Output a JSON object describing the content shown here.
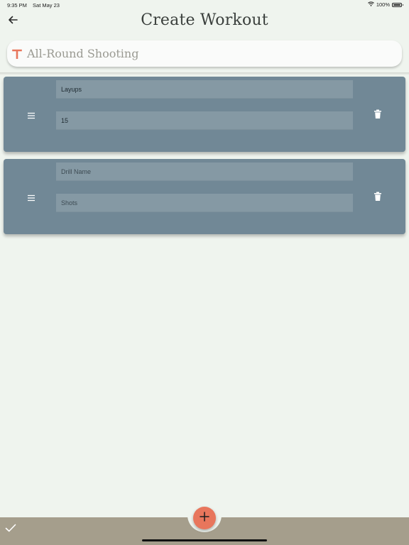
{
  "status_bar": {
    "time": "9:35 PM",
    "date": "Sat May 23",
    "battery": "100%",
    "icons": [
      "wifi-icon",
      "battery-icon"
    ]
  },
  "header": {
    "title": "Create Workout",
    "back_icon": "arrow-left-icon"
  },
  "workout_name": {
    "value": "All-Round Shooting",
    "icon": "text-t-icon"
  },
  "drills": [
    {
      "name_value": "Layups",
      "name_placeholder": "Drill Name",
      "shots_value": "15",
      "shots_placeholder": "Shots",
      "handle_icon": "drag-handle-icon",
      "delete_icon": "trash-icon"
    },
    {
      "name_value": "",
      "name_placeholder": "Drill Name",
      "shots_value": "",
      "shots_placeholder": "Shots",
      "handle_icon": "drag-handle-icon",
      "delete_icon": "trash-icon"
    }
  ],
  "bottom_bar": {
    "confirm_icon": "check-icon",
    "add_icon": "plus-icon"
  },
  "colors": {
    "background": "#eff4ee",
    "card": "#718896",
    "field": "#8599a4",
    "accent": "#e8765c",
    "bottom_bar": "#a59e8c"
  }
}
